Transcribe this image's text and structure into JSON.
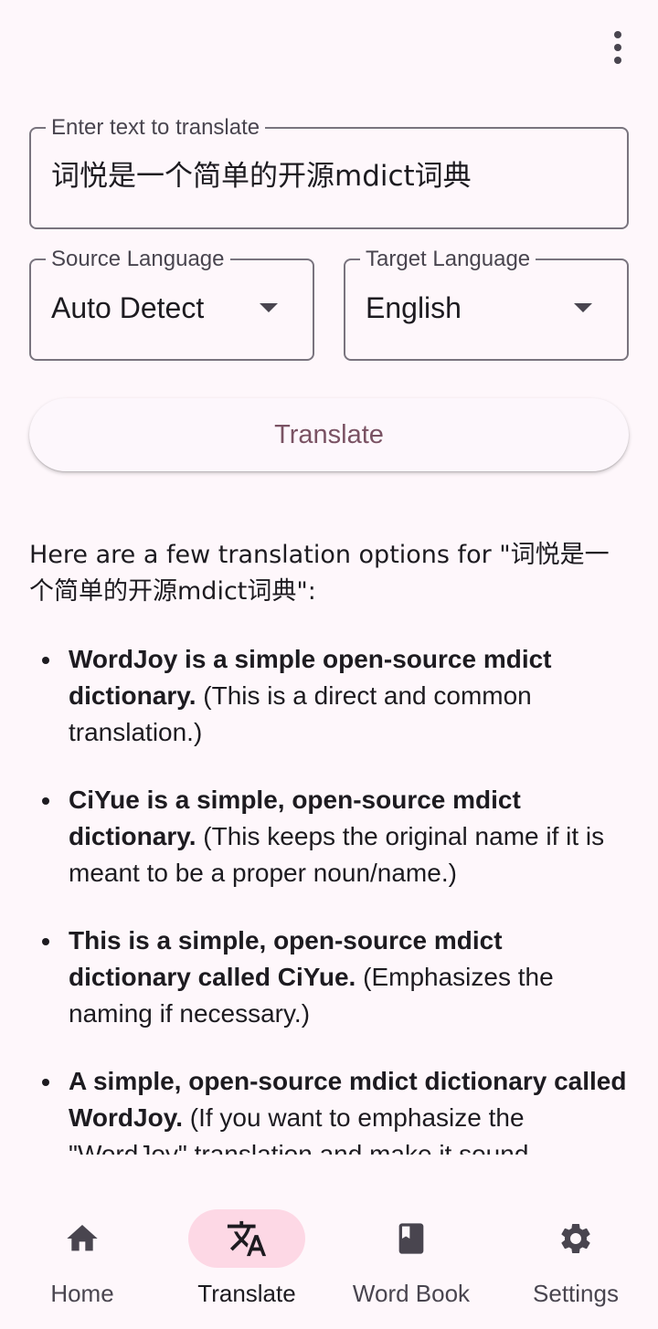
{
  "app": {
    "menu_icon": "more-vert-icon"
  },
  "input": {
    "label": "Enter text to translate",
    "value": "词悦是一个简单的开源mdict词典"
  },
  "source_language": {
    "label": "Source Language",
    "value": "Auto Detect"
  },
  "target_language": {
    "label": "Target Language",
    "value": "English"
  },
  "translate_button": {
    "label": "Translate"
  },
  "result": {
    "intro": "Here are a few translation options for \"词悦是一个简单的开源mdict词典\":",
    "options": [
      {
        "bold": "WordJoy is a simple open-source mdict dictionary.",
        "note": " (This is a direct and common translation.)"
      },
      {
        "bold": "CiYue is a simple, open-source mdict dictionary.",
        "note": " (This keeps the original name if it is meant to be a proper noun/name.)"
      },
      {
        "bold": "This is a simple, open-source mdict dictionary called CiYue.",
        "note": " (Emphasizes the naming if necessary.)"
      },
      {
        "bold": "A simple, open-source mdict dictionary called WordJoy.",
        "note": " (If you want to emphasize the \"WordJoy\" translation and make it sound"
      }
    ]
  },
  "nav": {
    "items": [
      {
        "label": "Home",
        "icon": "home-icon",
        "active": false
      },
      {
        "label": "Translate",
        "icon": "translate-icon",
        "active": true
      },
      {
        "label": "Word Book",
        "icon": "book-icon",
        "active": false
      },
      {
        "label": "Settings",
        "icon": "gear-icon",
        "active": false
      }
    ]
  },
  "colors": {
    "background": "#fef7fb",
    "accent": "#7a5263",
    "active_indicator": "#fdd8e5",
    "outline": "#79747e"
  }
}
